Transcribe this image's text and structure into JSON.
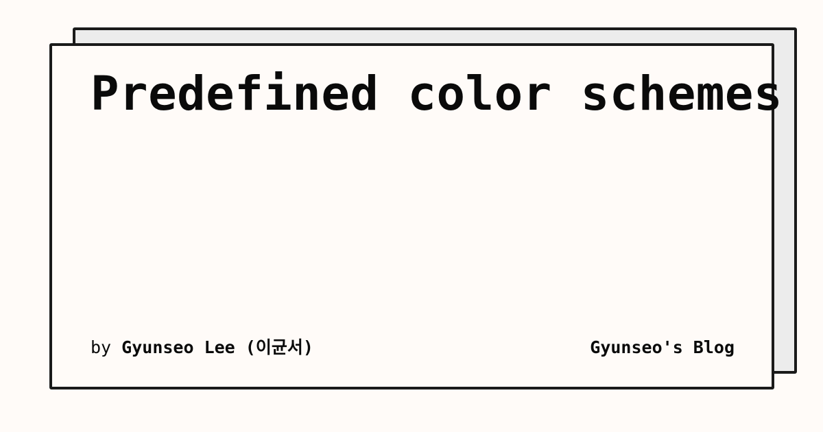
{
  "post": {
    "title": "Predefined color schemes",
    "byline_prefix": "by",
    "author": "Gyunseo Lee (이균서)"
  },
  "blog": {
    "name": "Gyunseo's Blog"
  },
  "colors": {
    "background": "#fffbf8",
    "card": "#fffbf8",
    "shadow_card": "#ececec",
    "border": "#1a1a1a",
    "text": "#0a0a0a"
  }
}
